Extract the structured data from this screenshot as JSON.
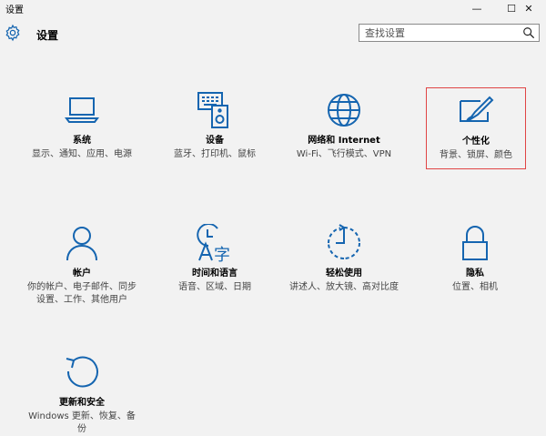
{
  "window": {
    "title": "设置",
    "min": "—",
    "max": "☐",
    "close": "✕"
  },
  "header": {
    "title": "设置",
    "search_placeholder": "查找设置"
  },
  "accent": "#1565b0",
  "tiles": [
    {
      "name": "系统",
      "desc": "显示、通知、应用、电源",
      "icon": "laptop-icon"
    },
    {
      "name": "设备",
      "desc": "蓝牙、打印机、鼠标",
      "icon": "devices-icon"
    },
    {
      "name": "网络和 Internet",
      "desc": "Wi-Fi、飞行模式、VPN",
      "icon": "globe-icon"
    },
    {
      "name": "个性化",
      "desc": "背景、锁屏、颜色",
      "icon": "personalization-icon"
    },
    {
      "name": "帐户",
      "desc": "你的帐户、电子邮件、同步设置、工作、其他用户",
      "icon": "person-icon"
    },
    {
      "name": "时间和语言",
      "desc": "语音、区域、日期",
      "icon": "time-language-icon"
    },
    {
      "name": "轻松使用",
      "desc": "讲述人、放大镜、高对比度",
      "icon": "ease-of-access-icon"
    },
    {
      "name": "隐私",
      "desc": "位置、相机",
      "icon": "lock-icon"
    },
    {
      "name": "更新和安全",
      "desc": "Windows 更新、恢复、备份",
      "icon": "update-icon"
    }
  ]
}
